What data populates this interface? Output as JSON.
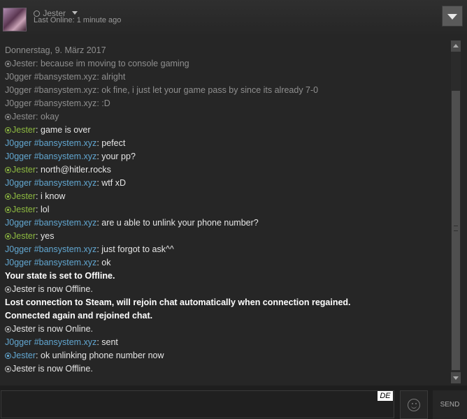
{
  "header": {
    "name": "Jester",
    "last_online": "Last Online: 1 minute ago"
  },
  "colors": {
    "timestamp": "#8f8f8f",
    "old_text": "#8f8f8f",
    "text": "#e6e6e6",
    "self_name": "#8db940",
    "friend_name": "#62a7d1",
    "system": "#ffffff"
  },
  "chat": {
    "messages": [
      {
        "type": "date",
        "text": "Donnerstag, 9. März 2017"
      },
      {
        "type": "msg",
        "old": true,
        "who": "self",
        "icon": true,
        "name": "Jester",
        "text": ": because im moving to console gaming"
      },
      {
        "type": "msg",
        "old": true,
        "who": "friend",
        "icon": false,
        "name": "J0gger #bansystem.xyz",
        "text": ": alright"
      },
      {
        "type": "msg",
        "old": true,
        "who": "friend",
        "icon": false,
        "name": "J0gger #bansystem.xyz",
        "text": ": ok fine, i just let your game pass by since its already 7-0"
      },
      {
        "type": "msg",
        "old": true,
        "who": "friend",
        "icon": false,
        "name": "J0gger #bansystem.xyz",
        "text": ": :D"
      },
      {
        "type": "msg",
        "old": true,
        "who": "self",
        "icon": true,
        "name": "Jester",
        "text": ": okay"
      },
      {
        "type": "msg",
        "old": false,
        "who": "self",
        "icon": true,
        "name": "Jester",
        "text": ": game is over"
      },
      {
        "type": "msg",
        "old": false,
        "who": "friend",
        "icon": false,
        "name": "J0gger #bansystem.xyz",
        "text": ": pefect"
      },
      {
        "type": "msg",
        "old": false,
        "who": "friend",
        "icon": false,
        "name": "J0gger #bansystem.xyz",
        "text": ": your pp?"
      },
      {
        "type": "msg",
        "old": false,
        "who": "self",
        "icon": true,
        "name": "Jester",
        "text": ": north@hitler.rocks"
      },
      {
        "type": "msg",
        "old": false,
        "who": "friend",
        "icon": false,
        "name": "J0gger #bansystem.xyz",
        "text": ": wtf xD"
      },
      {
        "type": "msg",
        "old": false,
        "who": "self",
        "icon": true,
        "name": "Jester",
        "text": ": i know"
      },
      {
        "type": "msg",
        "old": false,
        "who": "self",
        "icon": true,
        "name": "Jester",
        "text": ": lol"
      },
      {
        "type": "msg",
        "old": false,
        "who": "friend",
        "icon": false,
        "name": "J0gger #bansystem.xyz",
        "text": ": are u able to unlink your phone number?"
      },
      {
        "type": "msg",
        "old": false,
        "who": "self",
        "icon": true,
        "name": "Jester",
        "text": ": yes"
      },
      {
        "type": "msg",
        "old": false,
        "who": "friend",
        "icon": false,
        "name": "J0gger #bansystem.xyz",
        "text": ": just forgot to ask^^"
      },
      {
        "type": "msg",
        "old": false,
        "who": "friend",
        "icon": false,
        "name": "J0gger #bansystem.xyz",
        "text": ": ok"
      },
      {
        "type": "system",
        "bold": true,
        "icon": false,
        "text": "Your state is set to Offline."
      },
      {
        "type": "system",
        "bold": false,
        "icon": true,
        "text": "Jester is now Offline."
      },
      {
        "type": "system",
        "bold": true,
        "icon": false,
        "text": "Lost connection to Steam, will rejoin chat automatically when connection regained."
      },
      {
        "type": "system",
        "bold": true,
        "icon": false,
        "text": "Connected again and rejoined chat."
      },
      {
        "type": "system",
        "bold": false,
        "icon": true,
        "text": "Jester is now Online."
      },
      {
        "type": "msg",
        "old": false,
        "who": "friend",
        "icon": false,
        "name": "J0gger #bansystem.xyz",
        "text": ": sent"
      },
      {
        "type": "msg",
        "old": false,
        "who": "friend",
        "icon": true,
        "name": "Jester",
        "text": ": ok unlinking phone number now"
      },
      {
        "type": "system",
        "bold": false,
        "icon": true,
        "text": "Jester is now Offline."
      }
    ]
  },
  "input": {
    "lang": "DE",
    "send": "SEND"
  }
}
